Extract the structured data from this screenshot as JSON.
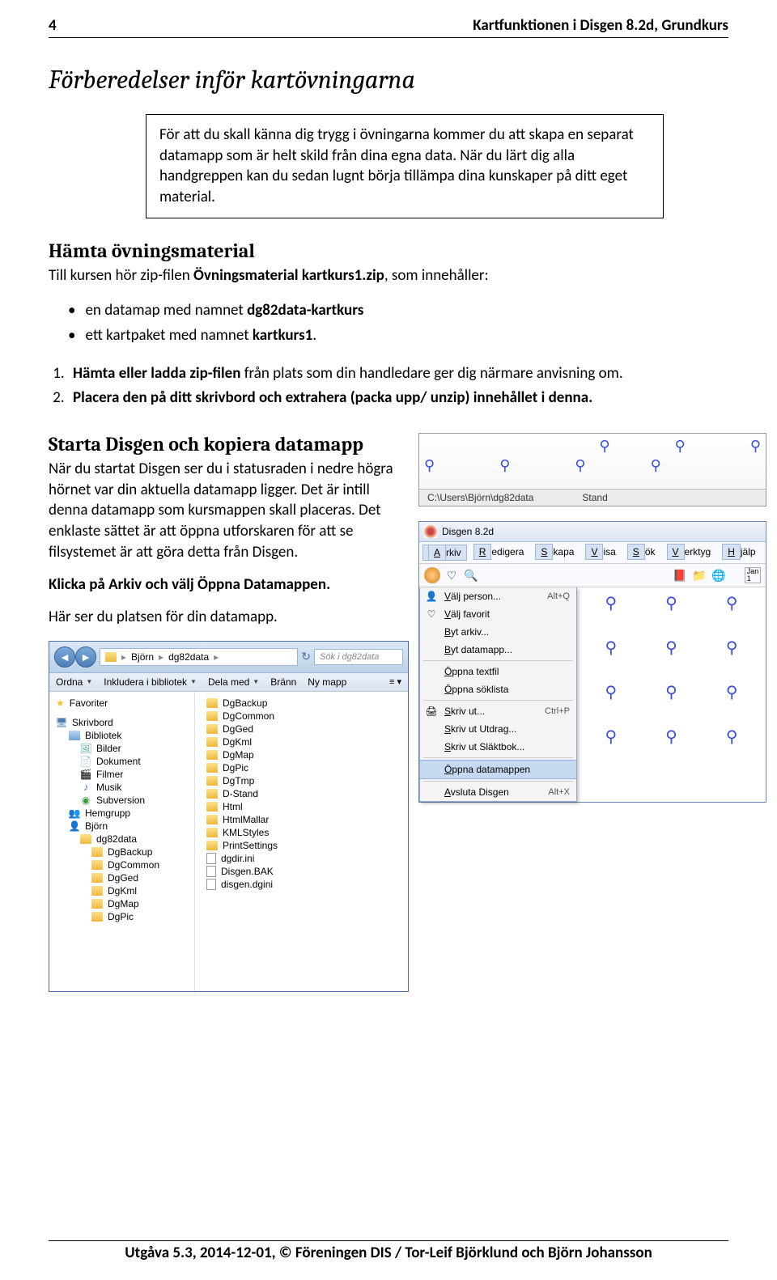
{
  "header": {
    "page_number": "4",
    "title_right": "Kartfunktionen i Disgen 8.2d, Grundkurs"
  },
  "section1": {
    "title": "Förberedelser inför kartövningarna",
    "box_text": "För att du skall känna dig trygg i övningarna kommer du att skapa en separat datamapp som är helt skild från dina egna data. När du lärt dig alla handgreppen kan du sedan lugnt börja tillämpa dina kunskaper på ditt eget material."
  },
  "section2": {
    "heading": "Hämta övningsmaterial",
    "p1a": "Till kursen hör zip-filen ",
    "p1b": "Övningsmaterial kartkurs1.zip",
    "p1c": ", som innehåller:",
    "bullet1a": "en datamap med namnet ",
    "bullet1b": "dg82data-kartkurs",
    "bullet2a": "ett kartpaket med namnet ",
    "bullet2b": "kartkurs1",
    "bullet2c": ".",
    "num1a": "Hämta eller ladda zip-filen",
    "num1b": " från plats som din handledare ger dig närmare anvisning om.",
    "num2": "Placera den på ditt skrivbord och extrahera (packa upp/ unzip) innehållet i denna."
  },
  "section3": {
    "heading": "Starta Disgen och kopiera datamapp",
    "p1": "När du startat Disgen ser du i statusraden i nedre högra hörnet var din aktuella datamapp ligger. Det är intill denna datamapp som kursmappen skall placeras. Det enklaste sättet är att öppna utforskaren för att se filsystemet är att göra detta från Disgen.",
    "p2": "Klicka på Arkiv och välj Öppna Datamappen.",
    "p3": "Här ser du platsen för din datamapp."
  },
  "statusbar": {
    "path": "C:\\Users\\Björn\\dg82data",
    "mode": "Stand"
  },
  "menu": {
    "app_title": "Disgen 8.2d",
    "menubar": [
      "Arkiv",
      "Redigera",
      "Skapa",
      "Visa",
      "Sök",
      "Verktyg",
      "Hjälp"
    ],
    "items": [
      {
        "icon": "👤",
        "label": "Välj person...",
        "shortcut": "Alt+Q"
      },
      {
        "icon": "♡",
        "label": "Välj favorit"
      },
      {
        "icon": "",
        "label": "Byt arkiv..."
      },
      {
        "icon": "",
        "label": "Byt datamapp..."
      },
      {
        "sep": true
      },
      {
        "icon": "",
        "label": "Öppna textfil"
      },
      {
        "icon": "",
        "label": "Öppna söklista"
      },
      {
        "sep": true
      },
      {
        "icon": "🖨",
        "label": "Skriv ut...",
        "shortcut": "Ctrl+P"
      },
      {
        "icon": "",
        "label": "Skriv ut Utdrag..."
      },
      {
        "icon": "",
        "label": "Skriv ut Släktbok..."
      },
      {
        "sep": true
      },
      {
        "icon": "",
        "label": "Öppna datamappen",
        "hl": true
      },
      {
        "sep": true
      },
      {
        "icon": "",
        "label": "Avsluta Disgen",
        "shortcut": "Alt+X"
      }
    ]
  },
  "explorer": {
    "bc1": "Björn",
    "bc2": "dg82data",
    "search_placeholder": "Sök i dg82data",
    "toolbar": [
      "Ordna",
      "Inkludera i bibliotek",
      "Dela med",
      "Bränn",
      "Ny mapp"
    ],
    "nav": [
      {
        "type": "head",
        "icon": "star",
        "label": "Favoriter"
      },
      {
        "gap": true
      },
      {
        "type": "head",
        "icon": "lib",
        "label": "Skrivbord"
      },
      {
        "type": "sub",
        "icon": "libblue",
        "label": "Bibliotek"
      },
      {
        "type": "sub2",
        "icon": "pic",
        "label": "Bilder"
      },
      {
        "type": "sub2",
        "icon": "doc",
        "label": "Dokument"
      },
      {
        "type": "sub2",
        "icon": "film",
        "label": "Filmer"
      },
      {
        "type": "sub2",
        "icon": "music",
        "label": "Musik"
      },
      {
        "type": "sub2",
        "icon": "svn",
        "label": "Subversion"
      },
      {
        "type": "sub",
        "icon": "home",
        "label": "Hemgrupp"
      },
      {
        "type": "sub",
        "icon": "user",
        "label": "Björn"
      },
      {
        "type": "sub2",
        "icon": "folder",
        "label": "dg82data"
      },
      {
        "type": "sub3",
        "icon": "folder",
        "label": "DgBackup"
      },
      {
        "type": "sub3",
        "icon": "folder",
        "label": "DgCommon"
      },
      {
        "type": "sub3",
        "icon": "folder",
        "label": "DgGed"
      },
      {
        "type": "sub3",
        "icon": "folder",
        "label": "DgKml"
      },
      {
        "type": "sub3",
        "icon": "folder",
        "label": "DgMap"
      },
      {
        "type": "sub3",
        "icon": "folder",
        "label": "DgPic"
      }
    ],
    "list": [
      {
        "icon": "folder",
        "label": "DgBackup"
      },
      {
        "icon": "folder",
        "label": "DgCommon"
      },
      {
        "icon": "folder",
        "label": "DgGed"
      },
      {
        "icon": "folder",
        "label": "DgKml"
      },
      {
        "icon": "folder",
        "label": "DgMap"
      },
      {
        "icon": "folder",
        "label": "DgPic"
      },
      {
        "icon": "folder",
        "label": "DgTmp"
      },
      {
        "icon": "folder",
        "label": "D-Stand"
      },
      {
        "icon": "folder",
        "label": "Html"
      },
      {
        "icon": "folder",
        "label": "HtmlMallar"
      },
      {
        "icon": "folder",
        "label": "KMLStyles"
      },
      {
        "icon": "folder",
        "label": "PrintSettings"
      },
      {
        "icon": "file",
        "label": "dgdir.ini"
      },
      {
        "icon": "file",
        "label": "Disgen.BAK"
      },
      {
        "icon": "file",
        "label": "disgen.dgini"
      }
    ]
  },
  "footer": {
    "text": "Utgåva 5.3, 2014-12-01, © Föreningen DIS / Tor-Leif Björklund och Björn Johansson"
  }
}
